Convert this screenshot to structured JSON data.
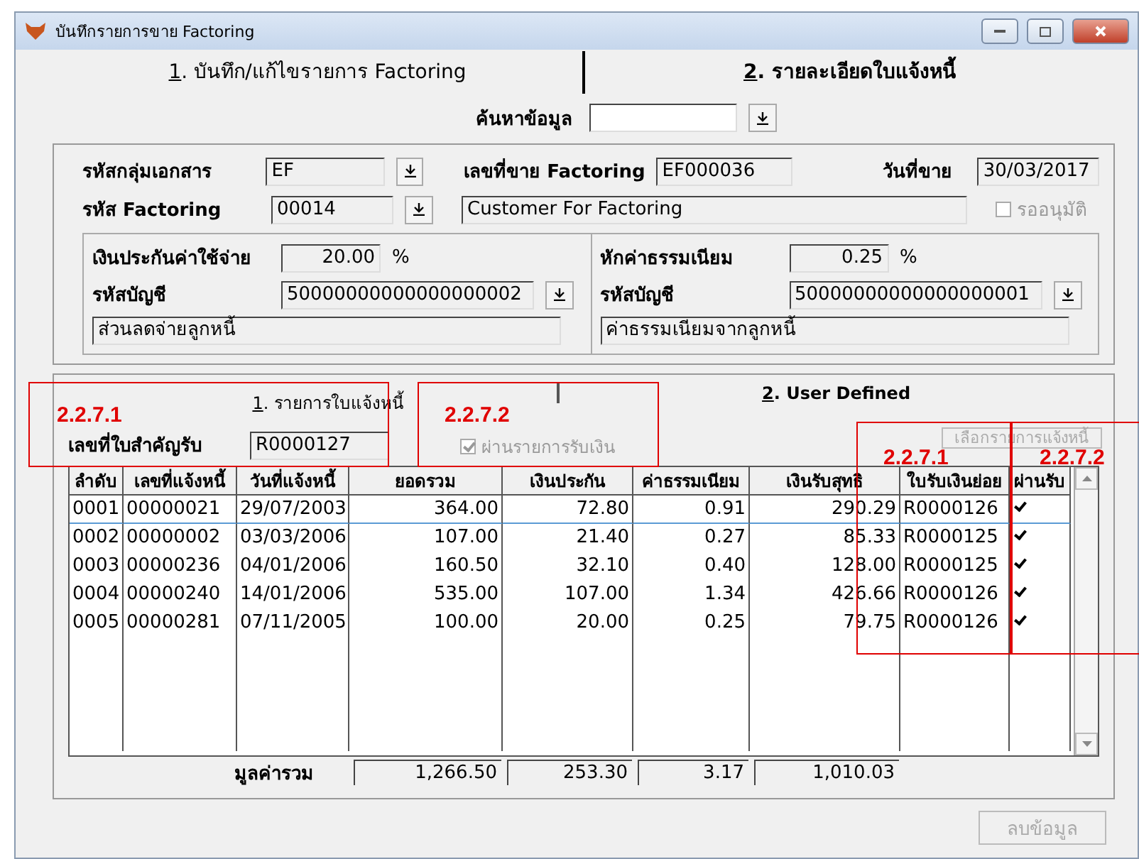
{
  "window": {
    "title": "บันทึกรายการขาย Factoring"
  },
  "tabs": [
    {
      "label": "1. บันทึก/แก้ไขรายการ Factoring",
      "selected": true
    },
    {
      "label": "2. รายละเอียดใบแจ้งหนี้",
      "selected": false
    }
  ],
  "search": {
    "label": "ค้นหาข้อมูล"
  },
  "header": {
    "doc_group": {
      "label": "รหัสกลุ่มเอกสาร",
      "value": "EF"
    },
    "sale_no": {
      "label": "เลขที่ขาย Factoring",
      "value": "EF000036"
    },
    "sale_date": {
      "label": "วันที่ขาย",
      "value": "30/03/2017"
    },
    "factoring_code": {
      "label": "รหัส Factoring",
      "value": "00014"
    },
    "customer": {
      "value": "Customer For Factoring"
    },
    "await_approval": {
      "label": "รออนุมัติ",
      "checked": false,
      "disabled": true
    }
  },
  "accounts": [
    {
      "rate_label": "เงินประกันค่าใช้จ่าย",
      "rate": "20.00",
      "unit": "%",
      "account_label": "รหัสบัญชี",
      "account": "50000000000000000002",
      "account_name": "ส่วนลดจ่ายลูกหนี้"
    },
    {
      "rate_label": "หักค่าธรรมเนียม",
      "rate": "0.25",
      "unit": "%",
      "account_label": "รหัสบัญชี",
      "account": "50000000000000000001",
      "account_name": "ค่าธรรมเนียมจากลูกหนี้"
    }
  ],
  "inner_tabs": [
    {
      "label": "1. รายการใบแจ้งหนี้",
      "selected": true
    },
    {
      "label": "2. User Defined",
      "selected": false
    }
  ],
  "receipt": {
    "label": "เลขที่ใบสำคัญรับ",
    "value": "R0000127"
  },
  "passed_filter": {
    "label": "ผ่านรายการรับเงิน",
    "checked": true,
    "disabled": true
  },
  "select_button": {
    "label": "เลือกรายการแจ้งหนี้",
    "disabled": true
  },
  "table": {
    "columns": [
      "ลำดับ",
      "เลขที่แจ้งหนี้",
      "วันที่แจ้งหนี้",
      "ยอดรวม",
      "เงินประกัน",
      "ค่าธรรมเนียม",
      "เงินรับสุทธิ",
      "ใบรับเงินย่อย",
      "ผ่านรับ"
    ],
    "rows": [
      {
        "selected": true,
        "cells": [
          "0001",
          "00000021",
          "29/07/2003",
          "364.00",
          "72.80",
          "0.91",
          "290.29",
          "R0000126"
        ],
        "passed": true
      },
      {
        "selected": false,
        "cells": [
          "0002",
          "00000002",
          "03/03/2006",
          "107.00",
          "21.40",
          "0.27",
          "85.33",
          "R0000125"
        ],
        "passed": true
      },
      {
        "selected": false,
        "cells": [
          "0003",
          "00000236",
          "04/01/2006",
          "160.50",
          "32.10",
          "0.40",
          "128.00",
          "R0000125"
        ],
        "passed": true
      },
      {
        "selected": false,
        "cells": [
          "0004",
          "00000240",
          "14/01/2006",
          "535.00",
          "107.00",
          "1.34",
          "426.66",
          "R0000126"
        ],
        "passed": true
      },
      {
        "selected": false,
        "cells": [
          "0005",
          "00000281",
          "07/11/2005",
          "100.00",
          "20.00",
          "0.25",
          "79.75",
          "R0000126"
        ],
        "passed": true
      }
    ]
  },
  "totals": {
    "label": "มูลค่ารวม",
    "values": [
      "1,266.50",
      "253.30",
      "3.17",
      "1,010.03"
    ]
  },
  "delete_button": {
    "label": "ลบข้อมูล",
    "disabled": true
  },
  "annotations": [
    {
      "label": "2.2.7.1"
    },
    {
      "label": "2.2.7.2"
    },
    {
      "label": "2.2.7.1"
    },
    {
      "label": "2.2.7.2"
    }
  ]
}
